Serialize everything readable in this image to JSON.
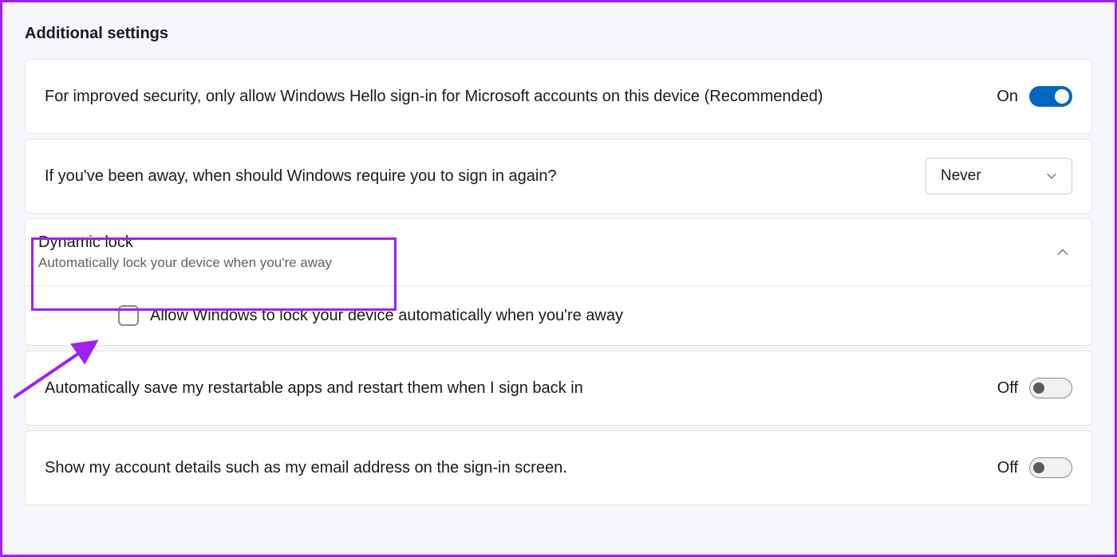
{
  "section_title": "Additional settings",
  "hello_signin": {
    "label": "For improved security, only allow Windows Hello sign-in for Microsoft accounts on this device (Recommended)",
    "state_text": "On"
  },
  "require_signin": {
    "label": "If you've been away, when should Windows require you to sign in again?",
    "dropdown_value": "Never"
  },
  "dynamic_lock": {
    "title": "Dynamic lock",
    "subtitle": "Automatically lock your device when you're away",
    "checkbox_label": "Allow Windows to lock your device automatically when you're away"
  },
  "restartable_apps": {
    "label": "Automatically save my restartable apps and restart them when I sign back in",
    "state_text": "Off"
  },
  "account_details": {
    "label": "Show my account details such as my email address on the sign-in screen.",
    "state_text": "Off"
  }
}
